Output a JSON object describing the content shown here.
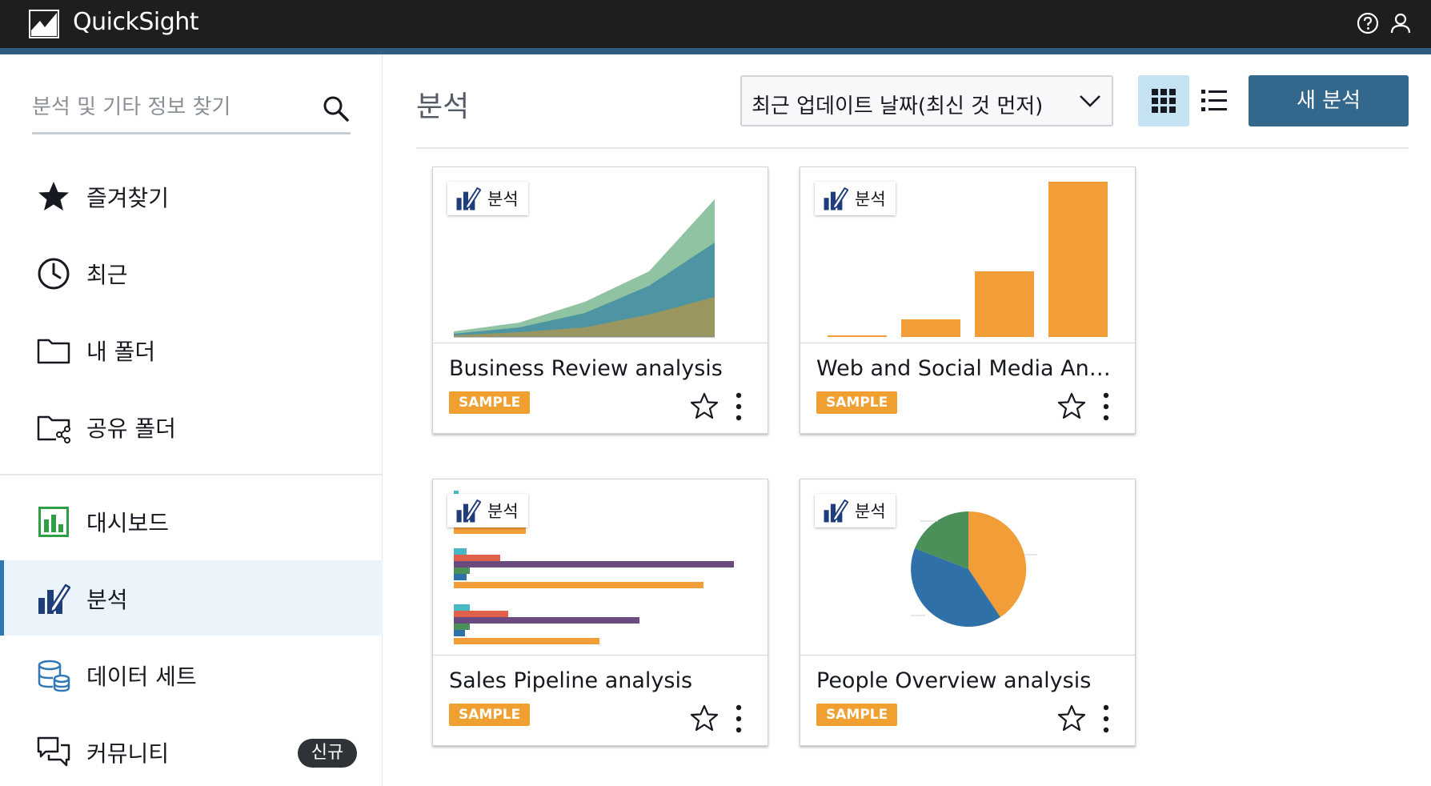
{
  "app": {
    "title": "QuickSight"
  },
  "search": {
    "placeholder": "분석 및 기타 정보 찾기"
  },
  "sidebar": {
    "items": [
      {
        "label": "즐겨찾기",
        "icon": "star-icon"
      },
      {
        "label": "최근",
        "icon": "clock-icon"
      },
      {
        "label": "내 폴더",
        "icon": "folder-icon"
      },
      {
        "label": "공유 폴더",
        "icon": "shared-folder-icon"
      },
      {
        "label": "대시보드",
        "icon": "dashboard-icon"
      },
      {
        "label": "분석",
        "icon": "analysis-icon",
        "active": true
      },
      {
        "label": "데이터 세트",
        "icon": "dataset-icon"
      },
      {
        "label": "커뮤니티",
        "icon": "community-icon",
        "badge": "신규"
      }
    ]
  },
  "main": {
    "title": "분석",
    "sort": {
      "selected": "최근 업데이트 날짜(최신 것 먼저)"
    },
    "new_button": "새 분석",
    "cards": [
      {
        "type_label": "분석",
        "title": "Business Review analysis",
        "badge": "SAMPLE",
        "thumbnail": "area-chart"
      },
      {
        "type_label": "분석",
        "title": "Web and Social Media Analytics analysis",
        "badge": "SAMPLE",
        "thumbnail": "bar-chart"
      },
      {
        "type_label": "분석",
        "title": "Sales Pipeline analysis",
        "badge": "SAMPLE",
        "thumbnail": "horizontal-bar-chart"
      },
      {
        "type_label": "분석",
        "title": "People Overview analysis",
        "badge": "SAMPLE",
        "thumbnail": "pie-chart"
      }
    ]
  },
  "colors": {
    "topbar": "#1e1e1e",
    "accent_stripe": "#2e5f80",
    "primary_button": "#33688c",
    "active_nav_bg": "#eaf4fa",
    "sample_badge": "#f0a030",
    "chart_orange": "#f29e38",
    "chart_teal_green": "#7fbc98",
    "chart_blue": "#3070a8",
    "chart_purple": "#6b4a7f",
    "chart_red": "#e0604c",
    "chart_green": "#4a9058",
    "chart_cyan": "#4ab8c0"
  }
}
